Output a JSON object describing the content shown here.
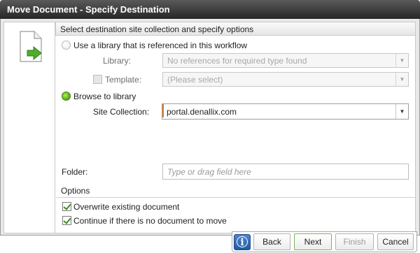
{
  "dialog": {
    "title": "Move Document - Specify Destination"
  },
  "section": {
    "header": "Select destination site collection and specify options"
  },
  "destination": {
    "option_workflow_label": "Use a library that is referenced in this workflow",
    "library_label": "Library:",
    "library_placeholder": "No references for required type found",
    "template_label": "Template:",
    "template_placeholder": "(Please select)",
    "option_browse_label": "Browse to library",
    "site_collection_label": "Site Collection:",
    "site_collection_value": "portal.denallix.com"
  },
  "folder": {
    "label": "Folder:",
    "placeholder": "Type or drag field here"
  },
  "options": {
    "header": "Options",
    "overwrite_label": "Overwrite existing document",
    "overwrite_checked": true,
    "continue_label": "Continue if there is no document to move",
    "continue_checked": true
  },
  "footer": {
    "info_label": "i",
    "back_label": "Back",
    "next_label": "Next",
    "finish_label": "Finish",
    "cancel_label": "Cancel"
  },
  "icons": {
    "document": "document-move-icon",
    "info": "info-icon",
    "dropdown": "chevron-down-icon"
  },
  "colors": {
    "title_bar": "#333333",
    "accent_green": "#6fc022",
    "active_bar": "#e4771c",
    "info_blue": "#2a66b3"
  }
}
